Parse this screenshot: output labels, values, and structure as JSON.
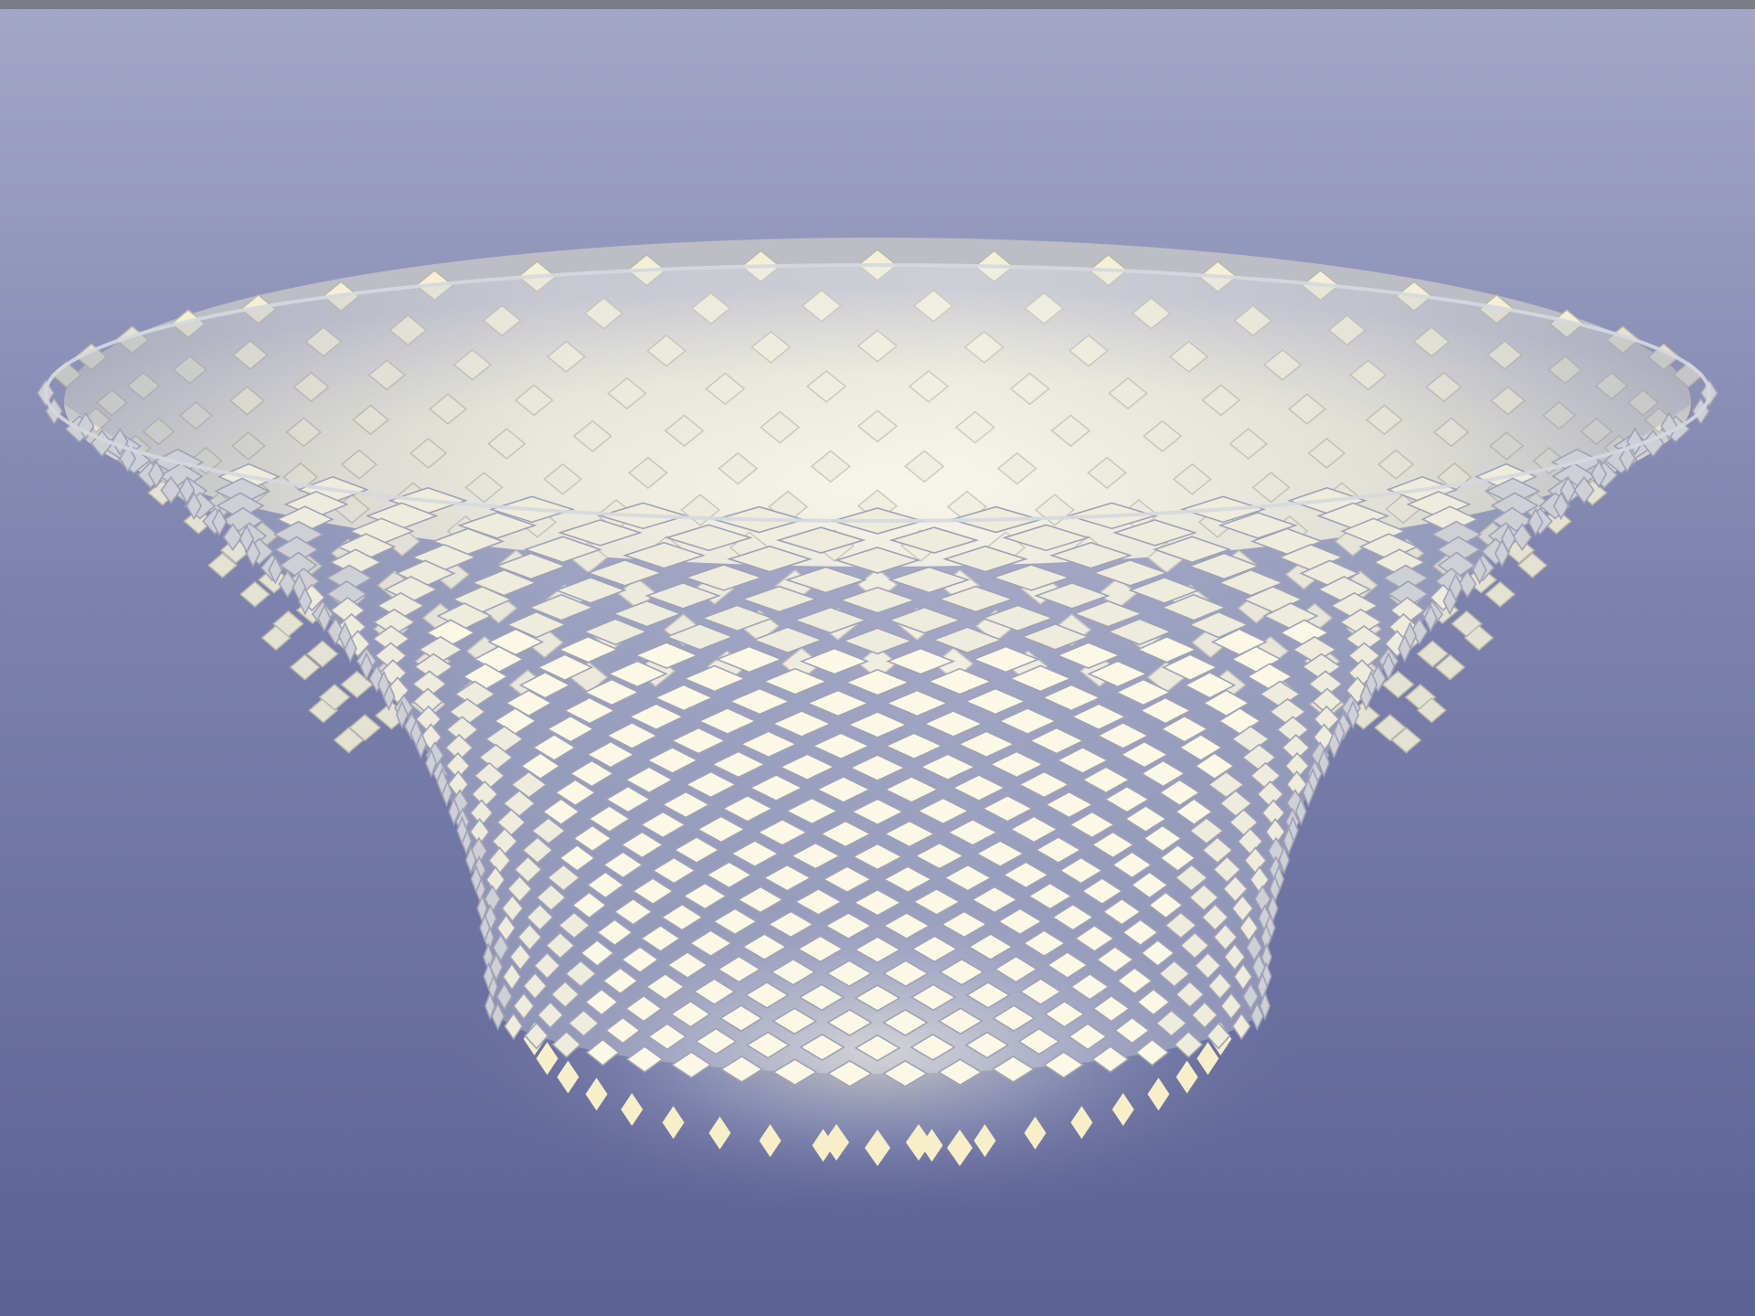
{
  "scene": {
    "subject": "lattice-bowl",
    "colors": {
      "backdrop_top": "#a3a6c6",
      "backdrop_bottom": "#646a98",
      "floor": "#5b6195",
      "lattice_frame": "#d5d8df",
      "inner_glow": "#fbf8e4",
      "lit_tile": "#f6efc9"
    }
  }
}
